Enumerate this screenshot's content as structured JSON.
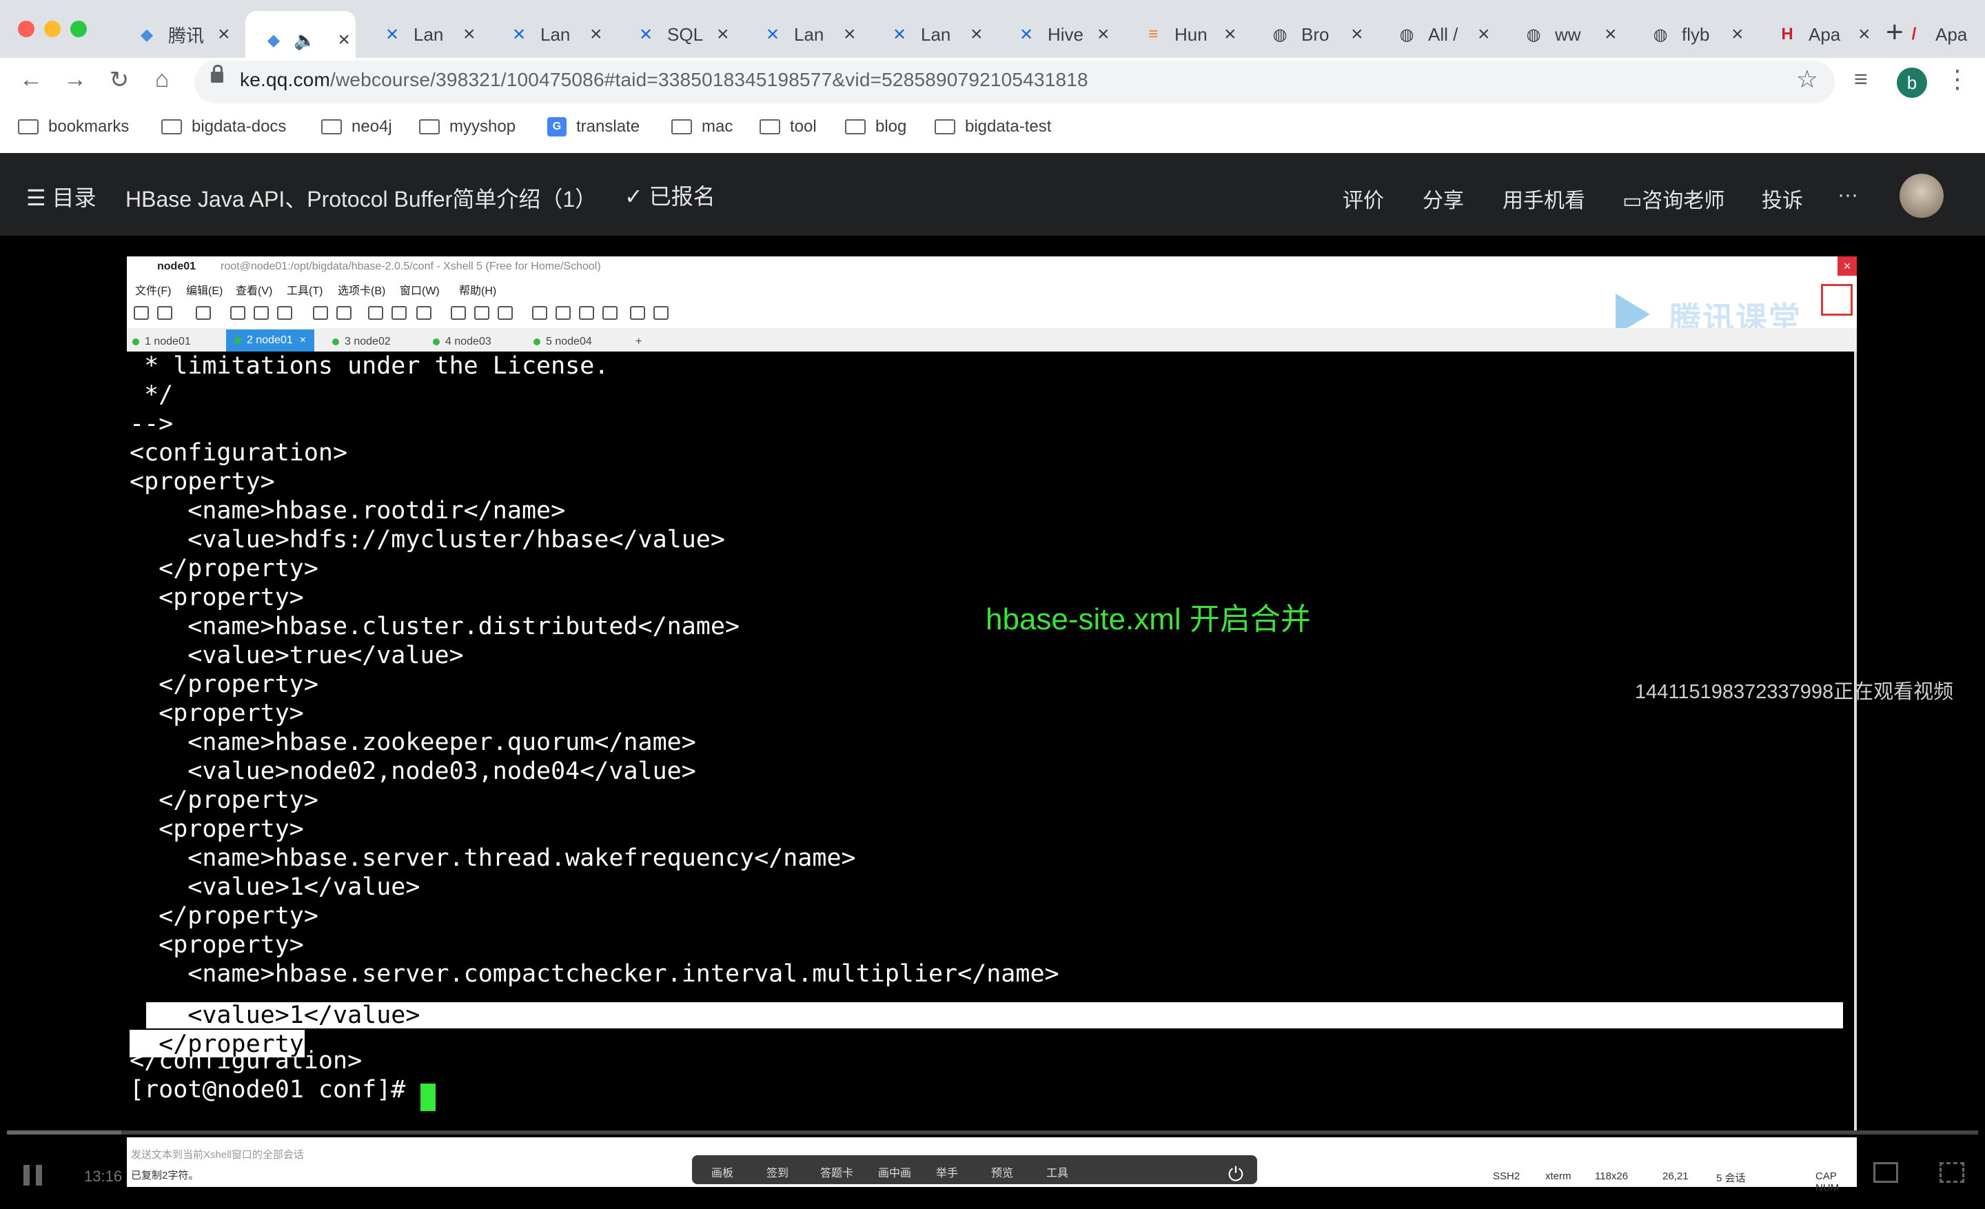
{
  "browser": {
    "tabs": [
      {
        "title": "腾讯",
        "icon": "tencent-class-icon",
        "color": "#4a8ee0"
      },
      {
        "title": "",
        "icon": "tencent-class-icon",
        "color": "#4a8ee0",
        "active": true,
        "audio": "🔈"
      },
      {
        "title": "Lan",
        "icon": "confluence-icon",
        "color": "#1868db"
      },
      {
        "title": "Lan",
        "icon": "confluence-icon",
        "color": "#1868db"
      },
      {
        "title": "SQL",
        "icon": "confluence-icon",
        "color": "#1868db"
      },
      {
        "title": "Lan",
        "icon": "confluence-icon",
        "color": "#1868db"
      },
      {
        "title": "Lan",
        "icon": "confluence-icon",
        "color": "#1868db"
      },
      {
        "title": "Hive",
        "icon": "confluence-icon",
        "color": "#1868db"
      },
      {
        "title": "Hun",
        "icon": "stackoverflow-icon",
        "color": "#f48024"
      },
      {
        "title": "Bro",
        "icon": "globe-icon",
        "color": "#3c4043"
      },
      {
        "title": "All /",
        "icon": "globe-icon",
        "color": "#3c4043"
      },
      {
        "title": "ww",
        "icon": "globe-icon",
        "color": "#3c4043"
      },
      {
        "title": "flyb",
        "icon": "globe-icon",
        "color": "#3c4043"
      },
      {
        "title": "Apa",
        "icon": "hbase-icon",
        "color": "#c7202c"
      },
      {
        "title": "Apa",
        "icon": "feather-icon",
        "color": "#d22128"
      }
    ],
    "new_tab": "+",
    "url_prefix": "ke.qq.com",
    "url_rest": "/webcourse/398321/100475086#taid=3385018345198577&vid=5285890792105431818",
    "profile_initial": "b",
    "bookmarks": [
      "bookmarks",
      "bigdata-docs",
      "neo4j",
      "myyshop",
      "translate",
      "mac",
      "tool",
      "blog",
      "bigdata-test"
    ]
  },
  "course": {
    "menu_label": "目录",
    "title": "HBase Java API、Protocol Buffer简单介绍（1）",
    "enrolled": "已报名",
    "actions": [
      "评价",
      "分享",
      "用手机看",
      "咨询老师",
      "投诉"
    ],
    "more": "···"
  },
  "xshell": {
    "session": "node01",
    "path": "root@node01:/opt/bigdata/hbase-2.0.5/conf - Xshell 5 (Free for Home/School)",
    "menus": [
      "文件(F)",
      "编辑(E)",
      "查看(V)",
      "工具(T)",
      "选项卡(B)",
      "窗口(W)",
      "帮助(H)"
    ],
    "tabs": [
      "1 node01",
      "2 node01",
      "3 node02",
      "4 node03",
      "5 node04"
    ],
    "active_tab": 1,
    "watermark": "腾讯课堂",
    "terminal_lines": [
      " * limitations under the License.",
      " */",
      "-->",
      "<configuration>",
      "<property>",
      "    <name>hbase.rootdir</name>",
      "    <value>hdfs://mycluster/hbase</value>",
      "  </property>",
      "  <property>",
      "    <name>hbase.cluster.distributed</name>",
      "    <value>true</value>",
      "  </property>",
      "  <property>",
      "    <name>hbase.zookeeper.quorum</name>",
      "    <value>node02,node03,node04</value>",
      "  </property>",
      "  <property>",
      "    <name>hbase.server.thread.wakefrequency</name>",
      "    <value>1</value>",
      "  </property>",
      "  <property>",
      "    <name>hbase.server.compactchecker.interval.multiplier</name>",
      "    <value>1</value>",
      "  </property>",
      "</configuration>",
      "[root@node01 conf]# "
    ],
    "status_hint": "发送文本到当前Xshell窗口的全部会话",
    "status_copied": "已复制2字符。",
    "status_right": [
      "SSH2",
      "xterm",
      "118x26",
      "26,21",
      "5 会话",
      "CAP NUM"
    ],
    "dock_items": [
      "画板",
      "签到",
      "答题卡",
      "画中画",
      "举手",
      "预览",
      "工具"
    ]
  },
  "video": {
    "annotation": "hbase-site.xml  开启合并",
    "watching": "144115198372337998正在观看视频",
    "time": "13:16",
    "progress_fraction": 0.058
  }
}
